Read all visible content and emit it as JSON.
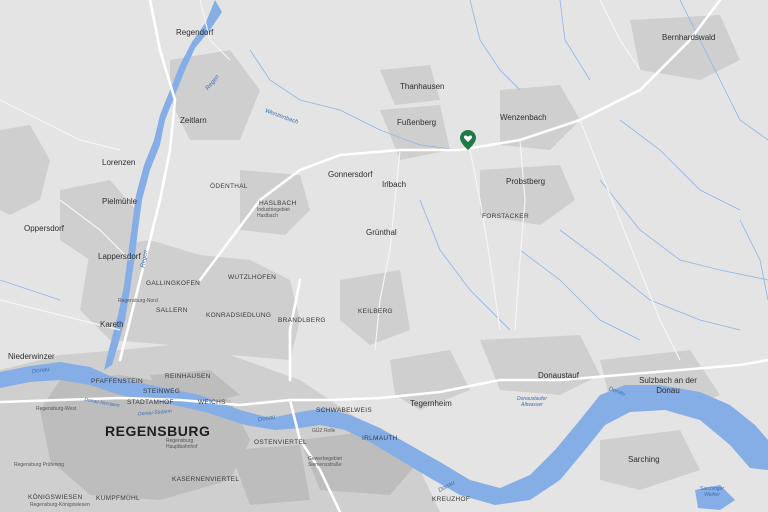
{
  "colors": {
    "background": "#e4e4e4",
    "urban": "#cfcfcf",
    "urban_dense": "#bdbdbd",
    "water": "#86aee6",
    "stream": "#8fb4e8",
    "road_main": "#ffffff",
    "road_minor": "#f5f5f5",
    "marker": "#1f7a45"
  },
  "marker": {
    "icon": "heart-map-pin-icon"
  },
  "labels": {
    "regendorf": "Regendorf",
    "zeitlarn": "Zeitlarn",
    "lorenzen": "Lorenzen",
    "pielmuhle": "Pielmühle",
    "oppersdorf": "Oppersdorf",
    "lappersdorf": "Lappersdorf",
    "kareth": "Kareth",
    "niederwinzer": "Niederwinzer",
    "odenthal": "ÖDENTHAL",
    "hasebach": "HASLBACH",
    "hasebach_sub": "Industriegebiet Haslbach",
    "gallingkofen": "GALLINGKOFEN",
    "regensburg_nord": "Regensburg-Nord",
    "sallern": "SALLERN",
    "wutzlhofen": "WUTZLHOFEN",
    "konradsiedlung": "KONRADSIEDLUNG",
    "brandlberg": "BRANDLBERG",
    "thanhausen": "Thanhausen",
    "fussenberg": "Fußenberg",
    "wenzenbach": "Wenzenbach",
    "gonnersdorf": "Gonnersdorf",
    "irlbach": "Irlbach",
    "probstberg": "Probstberg",
    "forstacker": "FORSTACKER",
    "grunthal": "Grünthal",
    "keilberg": "KEILBERG",
    "bernhardswald": "Bernhardswald",
    "donaustauf": "Donaustauf",
    "sulzbach": "Sulzbach an der Donau",
    "tegernheim": "Tegernheim",
    "schwabelweis": "SCHWABELWEIS",
    "reinhausen": "REINHAUSEN",
    "pfaffenstein": "PFAFFENSTEIN",
    "steinweg": "STEINWEG",
    "stadtamhof": "STADTAMHOF",
    "weichs": "WEICHS",
    "regensburg": "REGENSBURG",
    "regensburg_west": "Regensburg-West",
    "regensburg_prufening": "Regensburg Prüfening",
    "regensburg_hbf": "Regensburg Hauptbahnhof",
    "ostenviertel": "OSTENVIERTEL",
    "irlmauth": "IRLMAUTH",
    "gewerbegebiet": "Gewerbegebiet Siemensstraße",
    "guz": "GÜZ Rolle",
    "kasernenviertel": "KASERNENVIERTEL",
    "konigswiesen": "KÖNIGSWIESEN",
    "regensburg_konigswiesen": "Regensburg-Königswiesen",
    "kumpfmuhl": "KUMPFMÜHL",
    "kreuzhof": "KREUZHOF",
    "sarching": "Sarching",
    "sarchinger_weiher": "Sarchinger Weiher",
    "donaustaufer_altwasser": "Donaustaufer Altwasser",
    "river_donau_1": "Donau",
    "river_donau_2": "Donau",
    "river_donau_3": "Donau",
    "river_donau_4": "Donau",
    "river_regen_1": "Regen",
    "river_regen_2": "Regen",
    "wenzenbach_stream": "Wenzenbach",
    "donau_nordarm": "Donau-Nordarm",
    "donau_sudarm": "Donau-Südarm"
  }
}
